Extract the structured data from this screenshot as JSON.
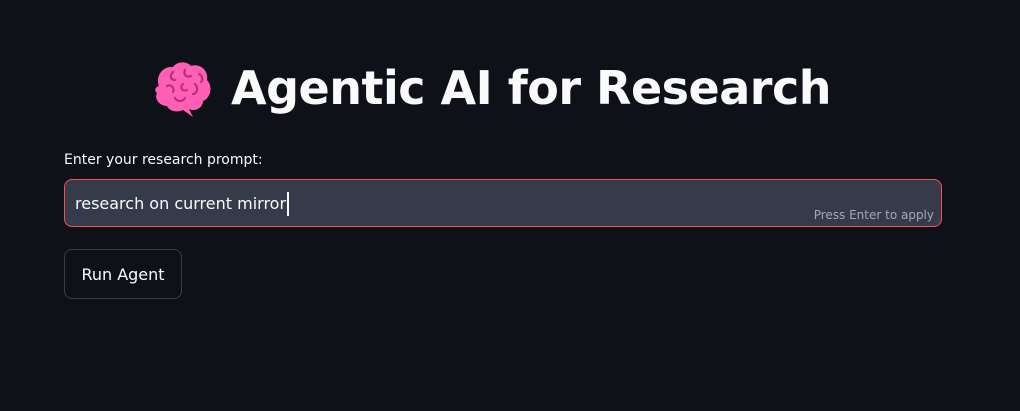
{
  "header": {
    "icon": "brain-icon",
    "title": "Agentic AI for Research"
  },
  "prompt": {
    "label": "Enter your research prompt:",
    "value": "research on current mirror",
    "hint": "Press Enter to apply"
  },
  "actions": {
    "run_label": "Run Agent"
  },
  "colors": {
    "background": "#0e1117",
    "input_background": "#363b4c",
    "focus_border": "#ff4b4b",
    "brain_pink": "#ff5fb4"
  }
}
